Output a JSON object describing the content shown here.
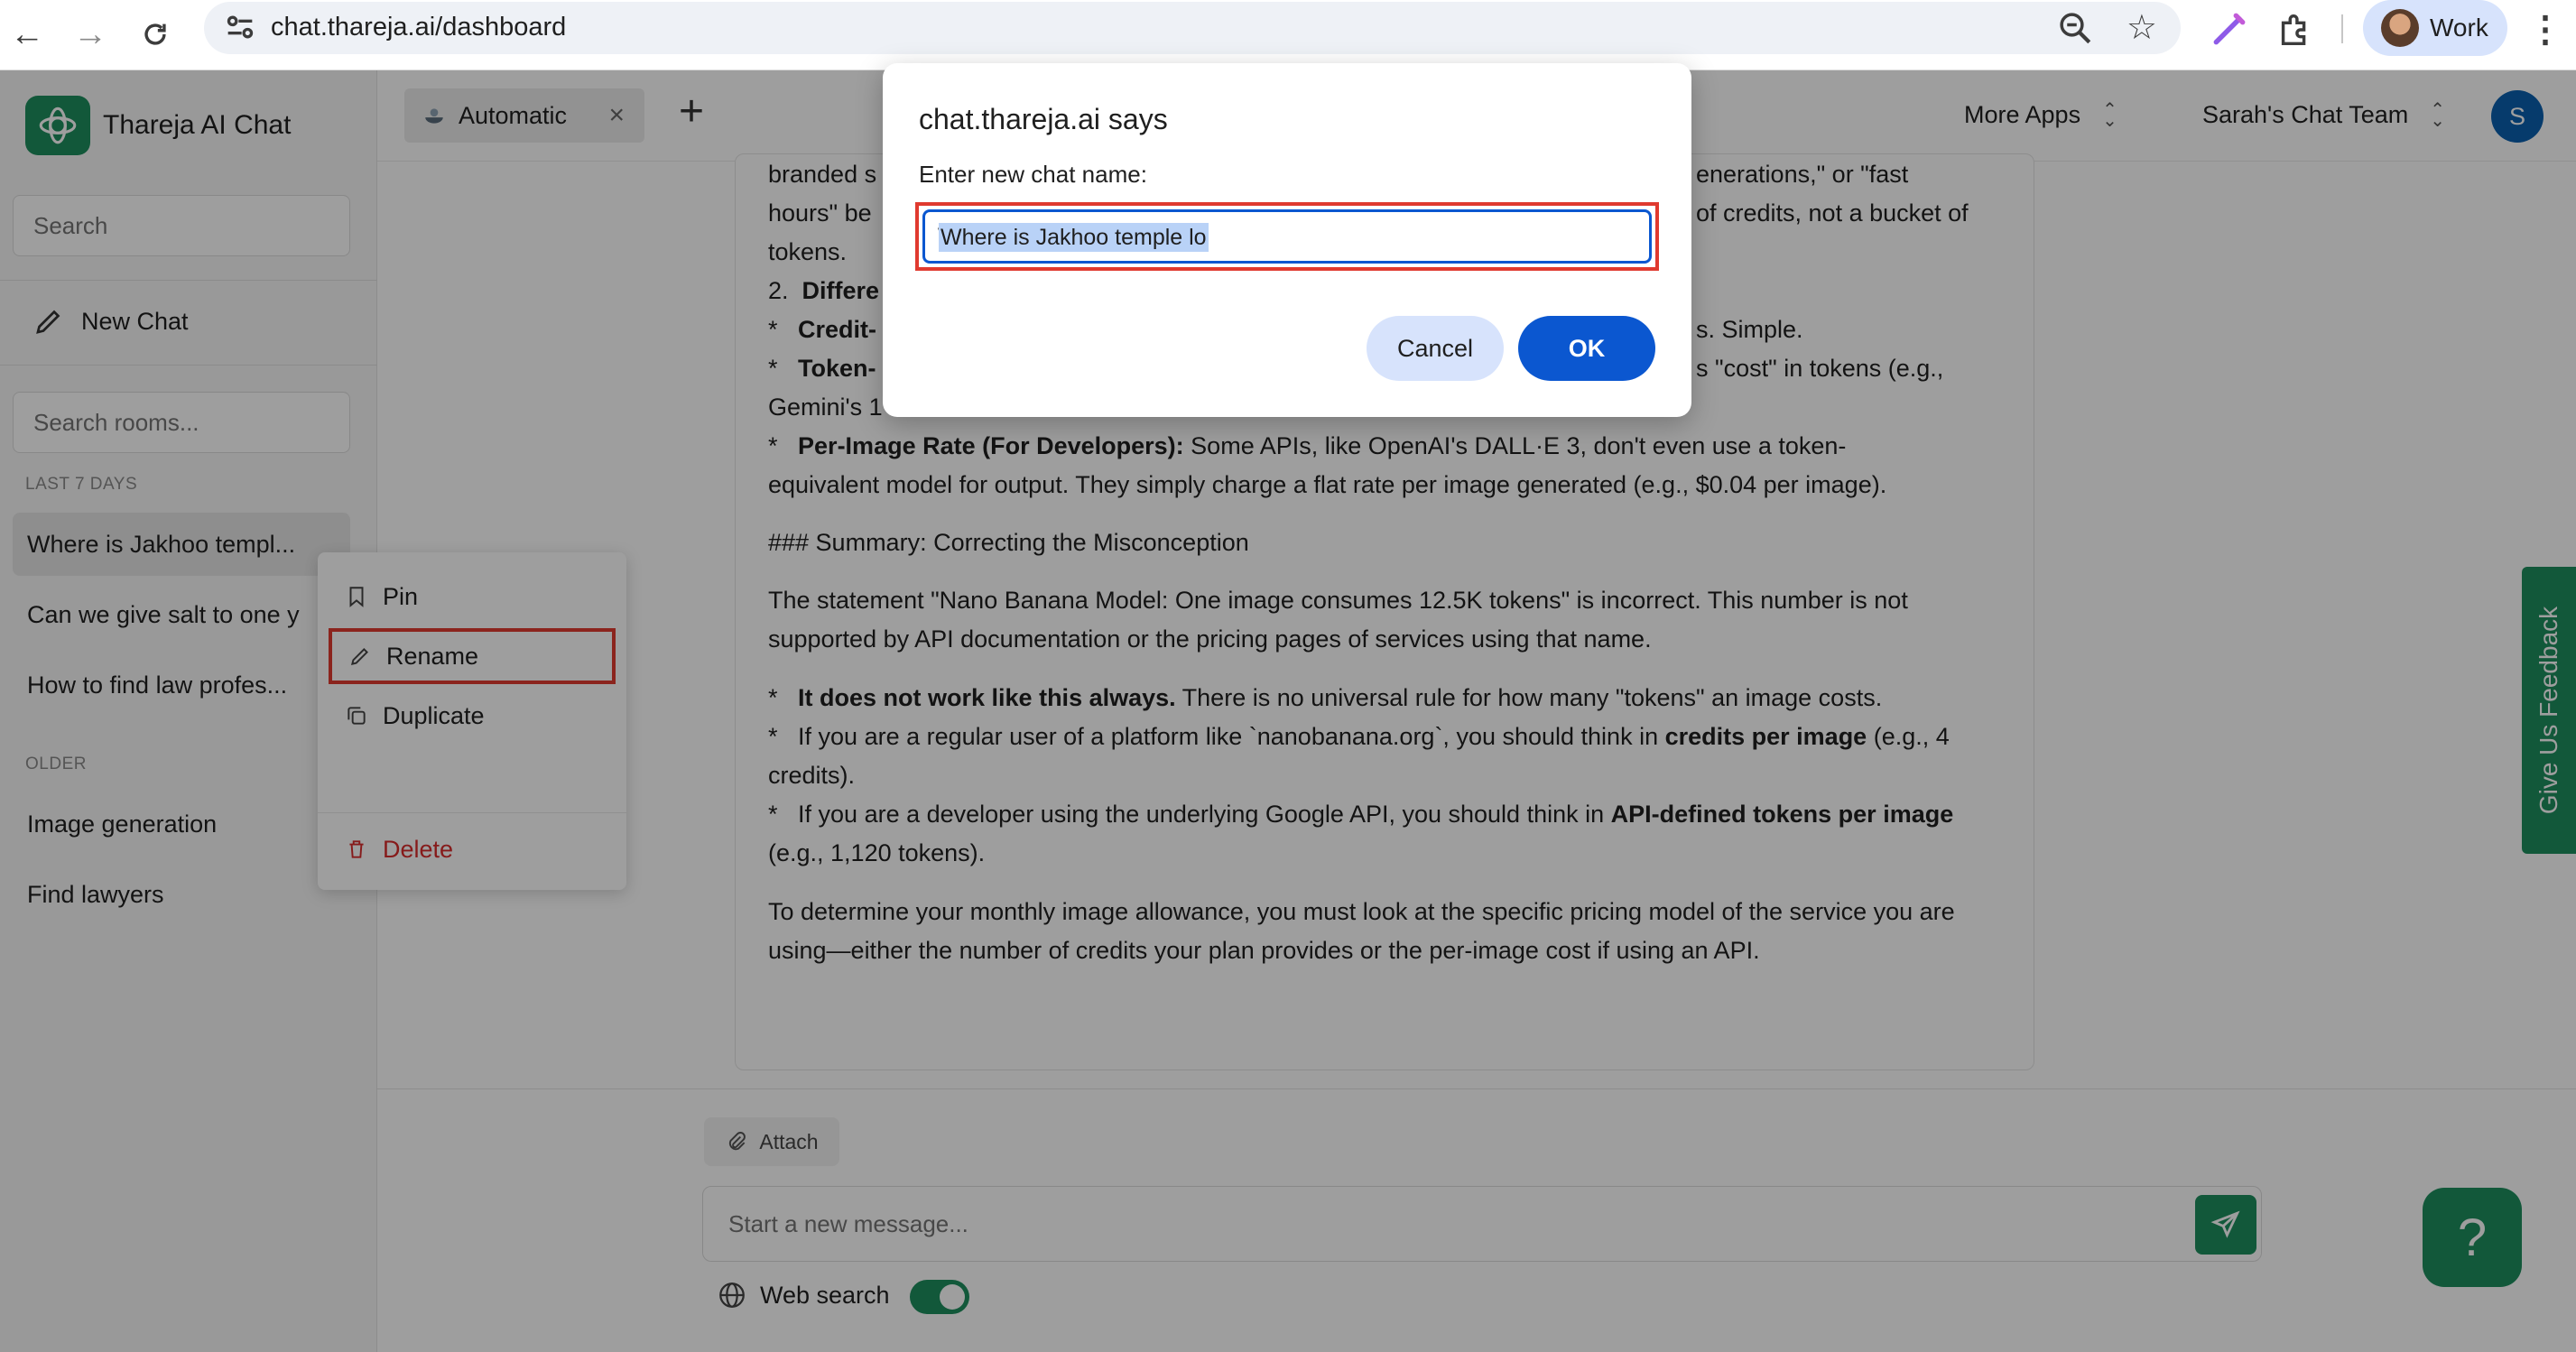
{
  "browser": {
    "url": "chat.thareja.ai/dashboard",
    "profile_label": "Work"
  },
  "sidebar": {
    "app_name": "Thareja AI Chat",
    "search_placeholder": "Search",
    "new_chat_label": "New Chat",
    "rooms_placeholder": "Search rooms...",
    "section_recent": "LAST 7 DAYS",
    "recent_chats": [
      {
        "title": "Where is Jakhoo templ..."
      },
      {
        "title": "Can we give salt to one y"
      },
      {
        "title": "How to find law profes..."
      }
    ],
    "section_older": "OLDER",
    "older_chats": [
      {
        "title": "Image generation"
      },
      {
        "title": "Find lawyers"
      }
    ]
  },
  "context_menu": {
    "pin": "Pin",
    "rename": "Rename",
    "duplicate": "Duplicate",
    "delete": "Delete"
  },
  "header": {
    "model_label": "Automatic",
    "model_close": "×",
    "plus": "+",
    "more_apps": "More Apps",
    "team": "Sarah's Chat Team",
    "avatar_initial": "S"
  },
  "message": {
    "line1a": "branded s",
    "line1b": "enerations,\" or \"fast",
    "line2a": "hours\" be",
    "line2b": "of credits, not a bucket of",
    "line3": "tokens.",
    "line4_num": "2.",
    "line4_bold": "Differe",
    "line5_bullet": "*",
    "line5_bold": "Credit-",
    "line5_tail": "s. Simple.",
    "line6_bullet": "*",
    "line6_bold": "Token-",
    "line6_tail": "s \"cost\" in tokens (e.g.,",
    "line7": "Gemini's 1",
    "line8_bullet": "*",
    "line8_bold": "Per-Image Rate (For Developers):",
    "line8_text": "Some APIs, like OpenAI's DALL·E 3, don't even use a token-",
    "line9": "equivalent model for output. They simply charge a flat rate per image generated (e.g., $0.04 per image).",
    "summary_heading": "### Summary: Correcting the Misconception",
    "summary_p1": "The statement \"Nano Banana Model: One image consumes 12.5K tokens\" is incorrect. This number is not supported by API documentation or the pricing pages of services using that name.",
    "b1_bullet": "*",
    "b1_bold": "It does not work like this always.",
    "b1_text": "There is no universal rule for how many \"tokens\" an image costs.",
    "b2_bullet": "*",
    "b2_text1": "If you are a regular user of a platform like `nanobanana.org`, you should think in",
    "b2_bold": "credits per image",
    "b2_text2": "(e.g., 4 credits).",
    "b3_bullet": "*",
    "b3_text1": "If you are a developer using the underlying Google API, you should think in",
    "b3_bold": "API-defined tokens per image",
    "b3_text2": "(e.g., 1,120 tokens).",
    "closing": "To determine your monthly image allowance, you must look at the specific pricing model of the service you are using—either the number of credits your plan provides or the per-image cost if using an API."
  },
  "feedback_label": "Give Us Feedback",
  "composer": {
    "attach_label": "Attach",
    "placeholder": "Start a new message...",
    "web_search_label": "Web search",
    "web_search_on": true,
    "help_glyph": "?"
  },
  "dialog": {
    "title": "chat.thareja.ai says",
    "message": "Enter new chat name:",
    "input_value": "Where is Jakhoo temple lo",
    "cancel_label": "Cancel",
    "ok_label": "OK"
  },
  "colors": {
    "brand_green": "#1d8f5e",
    "primary_blue": "#0b57d0",
    "highlight_red": "#e03a2f",
    "delete_red": "#d92d2d"
  }
}
